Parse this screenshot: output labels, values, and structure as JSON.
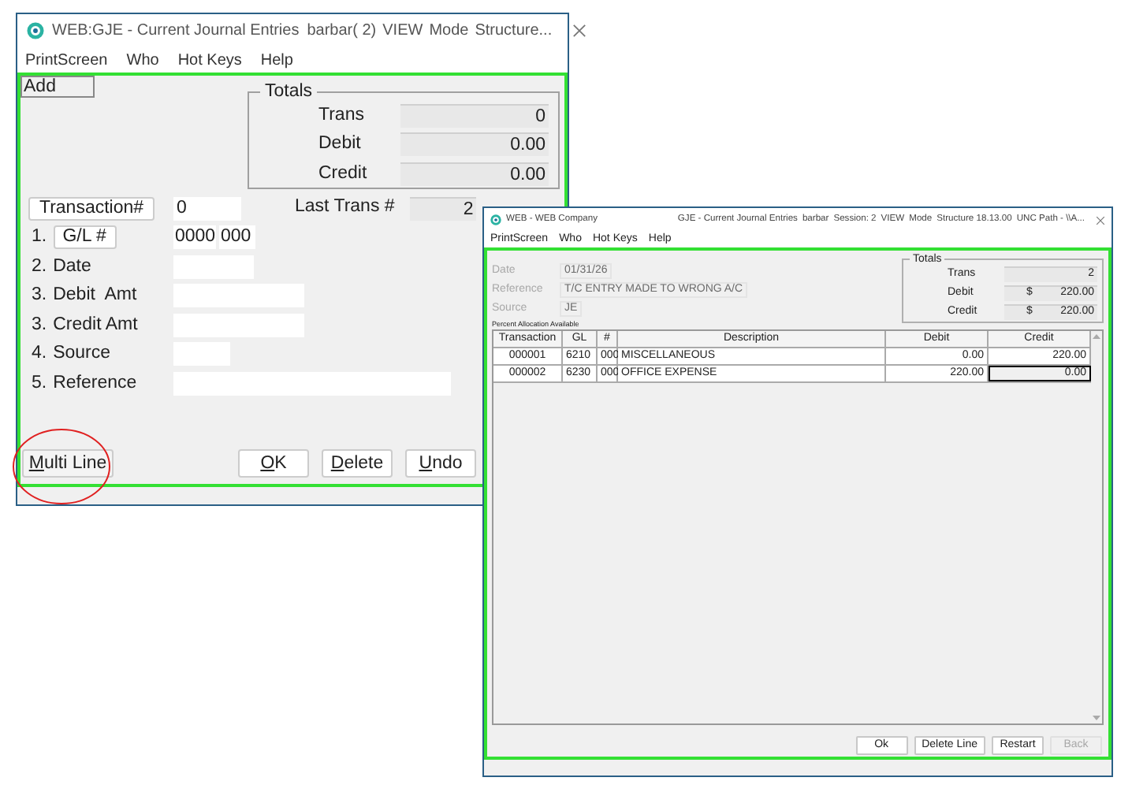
{
  "left_window": {
    "title": "WEB:GJE - Current Journal Entries",
    "status": [
      "barbar( 2)",
      "VIEW",
      "Mode",
      "Structure..."
    ],
    "menu": [
      "PrintScreen",
      "Who",
      "Hot Keys",
      "Help"
    ],
    "mode": "Add",
    "totals": {
      "title": "Totals",
      "rows": [
        {
          "label": "Trans",
          "value": "0"
        },
        {
          "label": "Debit",
          "value": "0.00"
        },
        {
          "label": "Credit",
          "value": "0.00"
        }
      ]
    },
    "transaction": {
      "button": "Transaction#",
      "value": "0",
      "last_label": "Last Trans #",
      "last_value": "2"
    },
    "fields": [
      {
        "number": "1.",
        "label": "G/L #",
        "kind": "button",
        "values": [
          "0000",
          "000"
        ]
      },
      {
        "number": "2.",
        "label": "Date",
        "kind": "input"
      },
      {
        "number": "3.",
        "label": "Debit  Amt",
        "kind": "input"
      },
      {
        "number": "3.",
        "label": "Credit Amt",
        "kind": "input"
      },
      {
        "number": "4.",
        "label": "Source",
        "kind": "input"
      },
      {
        "number": "5.",
        "label": "Reference",
        "kind": "input"
      }
    ],
    "buttons": [
      {
        "label": "Multi Line",
        "circled": true
      },
      {
        "label": "OK",
        "circled": false
      },
      {
        "label": "Delete",
        "circled": false
      },
      {
        "label": "Undo",
        "circled": false
      }
    ]
  },
  "right_window": {
    "company": "WEB - WEB Company",
    "title": "GJE - Current Journal Entries",
    "status": [
      "barbar",
      "Session: 2",
      "VIEW",
      "Mode",
      "Structure 18.13.00",
      "UNC Path - \\\\A..."
    ],
    "menu": [
      "PrintScreen",
      "Who",
      "Hot Keys",
      "Help"
    ],
    "header_fields": [
      {
        "label": "Date",
        "value": "01/31/26",
        "disabled": true
      },
      {
        "label": "Reference",
        "value": "T/C ENTRY MADE TO WRONG A/C",
        "disabled": true
      },
      {
        "label": "Source",
        "value": "JE",
        "disabled": true
      }
    ],
    "note": "Percent Allocation Available",
    "totals": {
      "title": "Totals",
      "rows": [
        {
          "label": "Trans",
          "currency": "",
          "value": "2"
        },
        {
          "label": "Debit",
          "currency": "$",
          "value": "220.00"
        },
        {
          "label": "Credit",
          "currency": "$",
          "value": "220.00"
        }
      ]
    },
    "table": {
      "columns": [
        "Transaction",
        "GL",
        "#",
        "Description",
        "Debit",
        "Credit"
      ],
      "rows": [
        {
          "cells": [
            {
              "text": "000001",
              "focused": false
            },
            {
              "text": "6210",
              "focused": false
            },
            {
              "text": "000",
              "focused": false
            },
            {
              "text": "MISCELLANEOUS",
              "focused": false
            },
            {
              "text": "0.00",
              "focused": false
            },
            {
              "text": "220.00",
              "focused": false
            }
          ]
        },
        {
          "cells": [
            {
              "text": "000002",
              "focused": false
            },
            {
              "text": "6230",
              "focused": false
            },
            {
              "text": "000",
              "focused": false
            },
            {
              "text": "OFFICE EXPENSE",
              "focused": false
            },
            {
              "text": "220.00",
              "focused": false
            },
            {
              "text": "0.00",
              "focused": true
            }
          ]
        }
      ]
    },
    "buttons": [
      {
        "label": "Ok",
        "disabled": false
      },
      {
        "label": "Delete Line",
        "disabled": false
      },
      {
        "label": "Restart",
        "disabled": false
      },
      {
        "label": "Back",
        "disabled": true
      }
    ]
  }
}
